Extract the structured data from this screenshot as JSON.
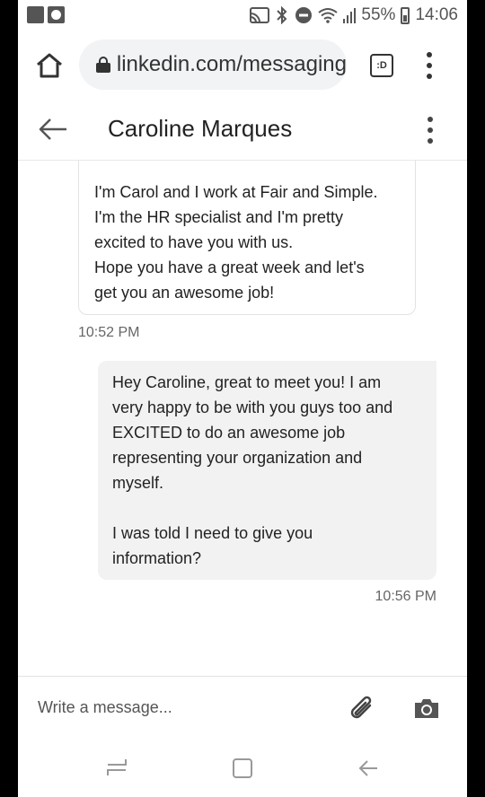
{
  "status_bar": {
    "battery": "55%",
    "time": "14:06",
    "icons": [
      "cast-icon",
      "bluetooth-icon",
      "do-not-disturb-icon",
      "wifi-icon",
      "signal-icon",
      "battery-icon"
    ]
  },
  "browser": {
    "url": "linkedin.com/messaging",
    "tab_count": ":D"
  },
  "conversation": {
    "contact_name": "Caroline Marques"
  },
  "messages": [
    {
      "direction": "incoming",
      "text": "I'm Carol and I work at Fair and Simple.\nI'm the HR specialist and I'm pretty\nexcited to have you with us.\nHope you have a great week and let's\nget you an awesome job!",
      "time": "10:52 PM"
    },
    {
      "direction": "outgoing",
      "text": "Hey Caroline, great to meet you! I am\nvery happy to be with you guys too and\nEXCITED to do an awesome job\nrepresenting your organization and\nmyself.\n\nI was told I need to give you\ninformation?",
      "time": "10:56 PM"
    }
  ],
  "composer": {
    "placeholder": "Write a message..."
  },
  "colors": {
    "outgoing_bubble": "#f2f2f2",
    "text": "#222222",
    "muted": "#666666"
  }
}
